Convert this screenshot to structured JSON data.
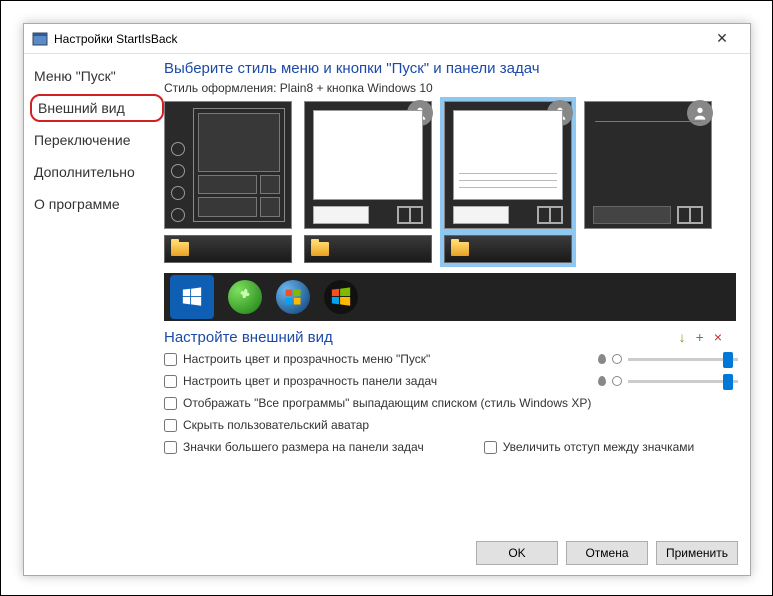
{
  "titlebar": {
    "title": "Настройки StartIsBack"
  },
  "sidebar": {
    "items": [
      {
        "label": "Меню \"Пуск\""
      },
      {
        "label": "Внешний вид"
      },
      {
        "label": "Переключение"
      },
      {
        "label": "Дополнительно"
      },
      {
        "label": "О программе"
      }
    ]
  },
  "main": {
    "heading": "Выберите стиль меню и кнопки \"Пуск\" и панели задач",
    "styleLabel": "Стиль оформления:  Plain8 + кнопка Windows 10",
    "subheading": "Настройте внешний вид",
    "toolbar": {
      "download": "↓",
      "add": "+",
      "remove": "×"
    },
    "options": {
      "startMenuColor": "Настроить цвет и прозрачность меню \"Пуск\"",
      "taskbarColor": "Настроить цвет и прозрачность панели задач",
      "allProgramsXP": "Отображать \"Все программы\" выпадающим списком (стиль Windows XP)",
      "hideAvatar": "Скрыть пользовательский аватар",
      "largeIcons": "Значки большего размера на панели задач",
      "widerSpacing": "Увеличить отступ между значками"
    },
    "sliders": {
      "s1": 90,
      "s2": 90
    }
  },
  "buttons": {
    "ok": "OK",
    "cancel": "Отмена",
    "apply": "Применить"
  }
}
